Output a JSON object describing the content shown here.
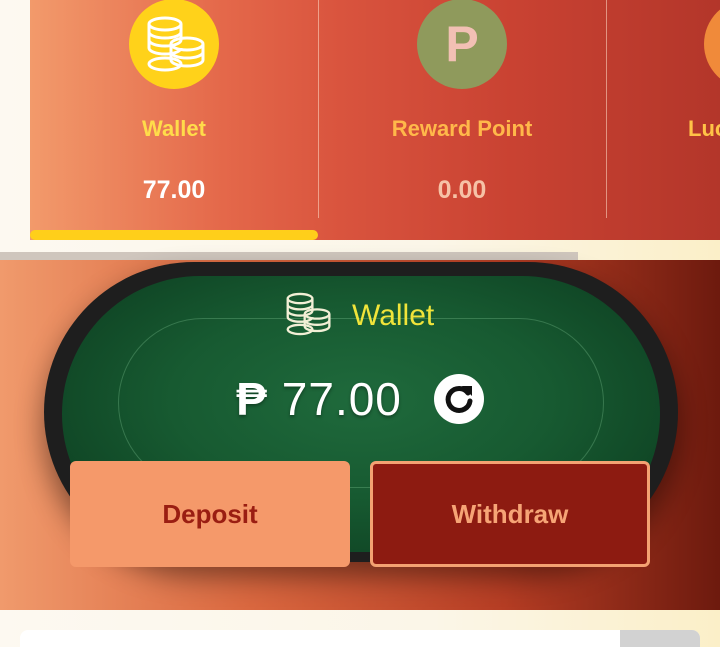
{
  "tabs": [
    {
      "label": "Wallet",
      "value": "77.00",
      "icon": "coins-icon"
    },
    {
      "label": "Reward Point",
      "value": "0.00",
      "icon": "p-icon",
      "icon_letter": "P"
    },
    {
      "label": "Luc",
      "icon": "coins-icon"
    }
  ],
  "active_tab": "Wallet",
  "wallet": {
    "title": "Wallet",
    "currency": "₱",
    "balance": "77.00",
    "deposit_label": "Deposit",
    "withdraw_label": "Withdraw"
  },
  "colors": {
    "accent_yellow": "#ffcf1a",
    "felt_green": "#175a31",
    "deposit_bg": "#f5996a",
    "withdraw_bg": "#8d1b11"
  }
}
